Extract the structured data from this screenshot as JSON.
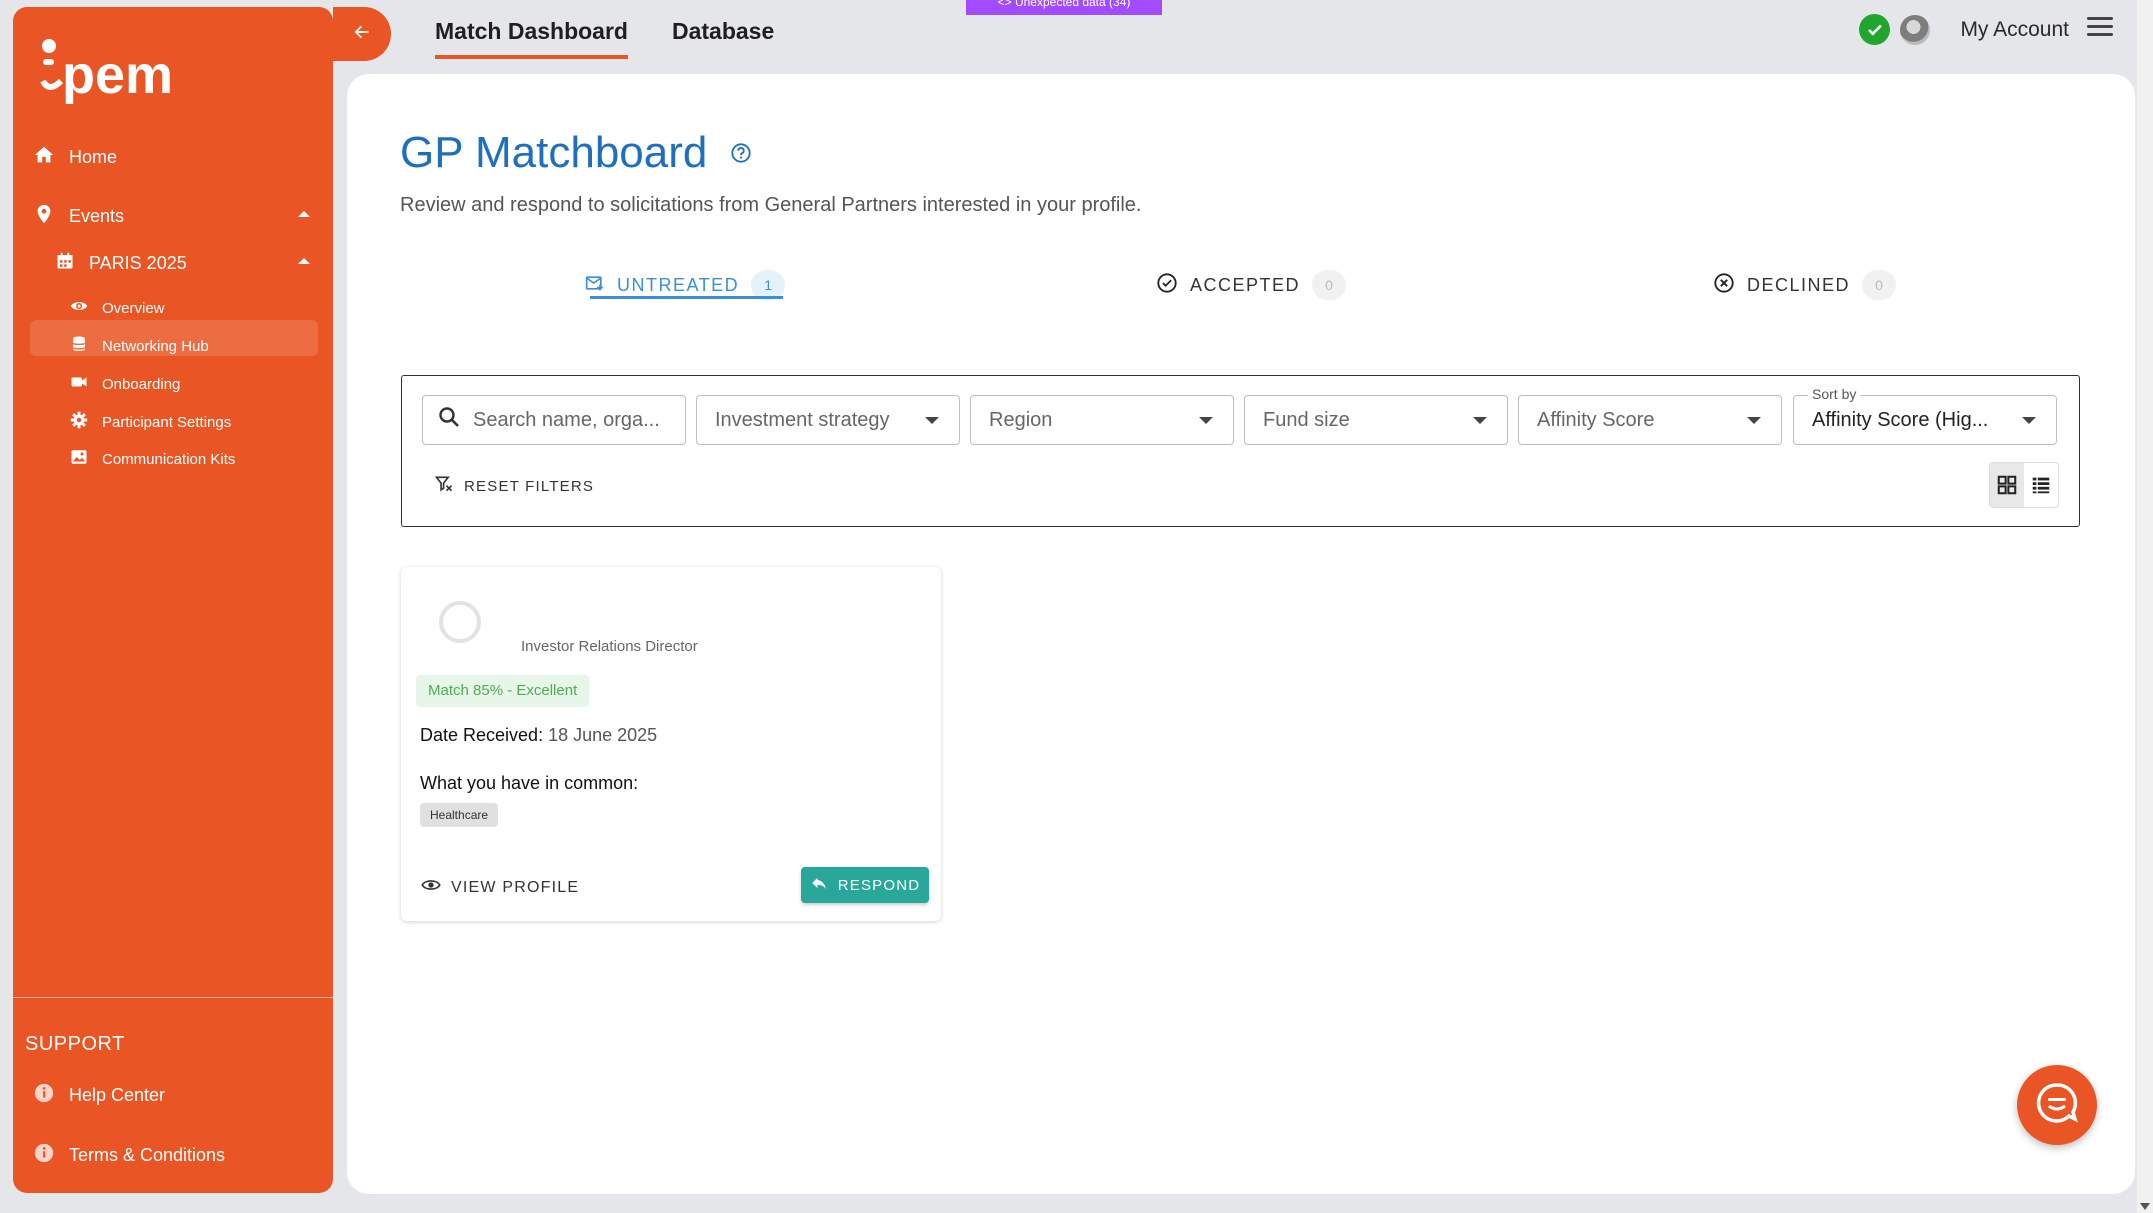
{
  "app": {
    "logo_text": "ipem",
    "brand_color": "#e95524",
    "accent_color": "#1e6fc0"
  },
  "sidebar": {
    "items": [
      {
        "label": "Home",
        "icon": "home-icon"
      },
      {
        "label": "Events",
        "icon": "map-pin-icon"
      },
      {
        "label": "PARIS 2025",
        "icon": "calendar-icon"
      },
      {
        "label": "Overview",
        "icon": "eye-icon"
      },
      {
        "label": "Networking Hub",
        "icon": "database-icon",
        "active": true
      },
      {
        "label": "Onboarding",
        "icon": "video-icon"
      },
      {
        "label": "Participant Settings",
        "icon": "gear-icon"
      },
      {
        "label": "Communication Kits",
        "icon": "image-icon"
      }
    ],
    "support_title": "SUPPORT",
    "support_items": [
      {
        "label": "Help Center",
        "icon": "info-icon"
      },
      {
        "label": "Terms & Conditions",
        "icon": "info-icon"
      }
    ]
  },
  "topnav": {
    "tabs": [
      {
        "label": "Match Dashboard",
        "active": true
      },
      {
        "label": "Database"
      }
    ],
    "debug_badge": "<> Unexpected data (34)",
    "account_label": "My Account"
  },
  "page": {
    "title": "GP Matchboard",
    "subtitle": "Review and respond to solicitations from General Partners interested in your profile.",
    "tabs": [
      {
        "label": "UNTREATED",
        "count": "1",
        "icon": "mail-icon"
      },
      {
        "label": "ACCEPTED",
        "count": "0",
        "icon": "check-circle-icon"
      },
      {
        "label": "DECLINED",
        "count": "0",
        "icon": "x-circle-icon"
      }
    ]
  },
  "filters": {
    "search_placeholder": "Search name, orga...",
    "investment_strategy": "Investment strategy",
    "region": "Region",
    "fund_size": "Fund size",
    "affinity_score": "Affinity Score",
    "sort_label": "Sort by",
    "sort_value": "Affinity Score (Hig...",
    "reset_label": "RESET FILTERS"
  },
  "cards": [
    {
      "role": "Investor Relations Director",
      "match": "Match 85% - Excellent",
      "date_label": "Date Received:",
      "date_value": "18 June 2025",
      "common_title": "What you have in common:",
      "tags": [
        "Healthcare"
      ],
      "view_profile": "VIEW PROFILE",
      "respond": "RESPOND"
    }
  ]
}
